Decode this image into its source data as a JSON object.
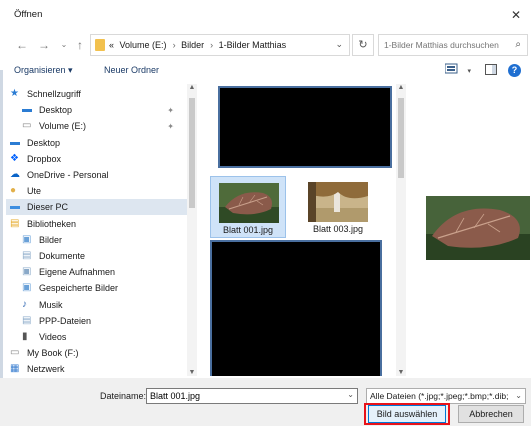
{
  "window": {
    "title": "Öffnen"
  },
  "address": {
    "crumbs": [
      "«",
      "Volume (E:)",
      "Bilder",
      "1-Bilder Matthias"
    ],
    "search_placeholder": "1-Bilder Matthias durchsuchen"
  },
  "toolbar": {
    "organize": "Organisieren ▾",
    "new_folder": "Neuer Ordner"
  },
  "nav": {
    "items": [
      {
        "label": "Schnellzugriff",
        "icon": "star-icon",
        "color": "#2b7cd3",
        "indent": 0,
        "pinned": false
      },
      {
        "label": "Desktop",
        "icon": "desktop-icon",
        "color": "#2b7cd3",
        "indent": 1,
        "pinned": true
      },
      {
        "label": "Volume (E:)",
        "icon": "drive-icon",
        "color": "#888888",
        "indent": 1,
        "pinned": true
      },
      {
        "label": "Desktop",
        "icon": "desktop-icon",
        "color": "#2b7cd3",
        "indent": 0,
        "pinned": false
      },
      {
        "label": "Dropbox",
        "icon": "dropbox-icon",
        "color": "#0061fe",
        "indent": 0,
        "pinned": false
      },
      {
        "label": "OneDrive - Personal",
        "icon": "onedrive-icon",
        "color": "#0a64c8",
        "indent": 0,
        "pinned": false
      },
      {
        "label": "Ute",
        "icon": "user-icon",
        "color": "#e2b04a",
        "indent": 0,
        "pinned": false
      },
      {
        "label": "Dieser PC",
        "icon": "pc-icon",
        "color": "#3d8ee0",
        "indent": 0,
        "pinned": false,
        "selected": true
      },
      {
        "label": "Bibliotheken",
        "icon": "library-icon",
        "color": "#e5a825",
        "indent": 0,
        "pinned": false
      },
      {
        "label": "Bilder",
        "icon": "pictures-icon",
        "color": "#6aa1d8",
        "indent": 1,
        "pinned": false
      },
      {
        "label": "Dokumente",
        "icon": "documents-icon",
        "color": "#8aa9c8",
        "indent": 1,
        "pinned": false
      },
      {
        "label": "Eigene Aufnahmen",
        "icon": "recordings-icon",
        "color": "#8aa9c8",
        "indent": 1,
        "pinned": false
      },
      {
        "label": "Gespeicherte Bilder",
        "icon": "pictures-icon",
        "color": "#6aa1d8",
        "indent": 1,
        "pinned": false
      },
      {
        "label": "Musik",
        "icon": "music-icon",
        "color": "#3b6fb6",
        "indent": 1,
        "pinned": false
      },
      {
        "label": "PPP-Dateien",
        "icon": "documents-icon",
        "color": "#8aa9c8",
        "indent": 1,
        "pinned": false
      },
      {
        "label": "Videos",
        "icon": "videos-icon",
        "color": "#555555",
        "indent": 1,
        "pinned": false
      },
      {
        "label": "My Book (F:)",
        "icon": "drive-icon",
        "color": "#888888",
        "indent": 0,
        "pinned": false
      },
      {
        "label": "Netzwerk",
        "icon": "network-icon",
        "color": "#3b7fd0",
        "indent": 0,
        "pinned": false
      }
    ]
  },
  "files": [
    {
      "name": "Blatt 001.jpg",
      "selected": true
    },
    {
      "name": "Blatt 003.jpg",
      "selected": false
    }
  ],
  "bottom": {
    "filename_label": "Dateiname:",
    "filename_value": "Blatt 001.jpg",
    "filetype": "Alle Dateien (*.jpg;*.jpeg;*.bmp;*.dib;",
    "open_button": "Bild auswählen",
    "cancel_button": "Abbrechen"
  },
  "colors": {
    "accent": "#0078d7",
    "highlight": "#e8131a",
    "selection": "#cfe3f8"
  }
}
